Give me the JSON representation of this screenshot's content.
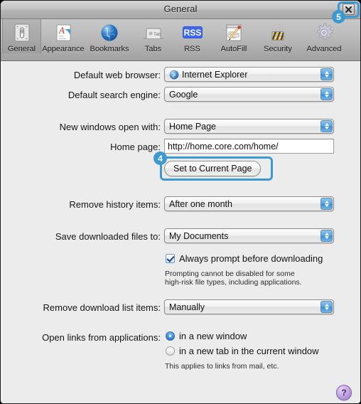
{
  "window": {
    "title": "General",
    "close_button": "close-icon"
  },
  "toolbar": {
    "items": [
      {
        "label": "General",
        "icon": "switchplate-icon",
        "selected": true
      },
      {
        "label": "Appearance",
        "icon": "appearance-icon",
        "selected": false
      },
      {
        "label": "Bookmarks",
        "icon": "globe-icon",
        "selected": false
      },
      {
        "label": "Tabs",
        "icon": "tabs-icon",
        "selected": false
      },
      {
        "label": "RSS",
        "icon": "rss-icon",
        "selected": false
      },
      {
        "label": "AutoFill",
        "icon": "autofill-icon",
        "selected": false
      },
      {
        "label": "Security",
        "icon": "padlock-icon",
        "selected": false
      },
      {
        "label": "Advanced",
        "icon": "gear-icon",
        "selected": false
      }
    ]
  },
  "form": {
    "default_browser": {
      "label": "Default web browser:",
      "value": "Internet Explorer",
      "icon": "internet-explorer-icon"
    },
    "default_search": {
      "label": "Default search engine:",
      "value": "Google"
    },
    "new_windows": {
      "label": "New windows open with:",
      "value": "Home Page"
    },
    "home_page": {
      "label": "Home page:",
      "value": "http://home.core.com/home/"
    },
    "set_current_page_button": "Set to Current Page",
    "remove_history": {
      "label": "Remove history items:",
      "value": "After one month"
    },
    "save_downloads": {
      "label": "Save downloaded files to:",
      "value": "My Documents"
    },
    "always_prompt": {
      "label": "Always prompt before downloading",
      "checked": true
    },
    "prompt_note_line1": "Prompting cannot be disabled for some",
    "prompt_note_line2": "high-risk file types, including applications.",
    "remove_download_list": {
      "label": "Remove download list items:",
      "value": "Manually"
    },
    "open_links": {
      "label": "Open links from applications:",
      "option1": "in a new window",
      "option2": "in a new tab in the current window",
      "selected": "in a new window",
      "note": "This applies to links from mail, etc."
    },
    "help_button": "?"
  },
  "annotations": {
    "accent_color": "#3d9ad1",
    "badge4": "4",
    "badge5": "5"
  }
}
